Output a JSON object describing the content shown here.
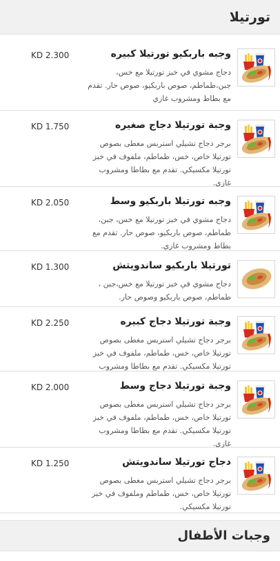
{
  "section_title": "تورتيلا",
  "kids_title": "وجبات الأطفال",
  "items": [
    {
      "name": "وجبه باربكيو تورتيلا كبيره",
      "desc": "دجاج مشوي في خبز تورتيلا مع خس، جبن،طماطم، صوص باربكيو، صوص حار. تقدم مع بطاط ومشروب غازي",
      "price": "KD 2.300",
      "meal": true
    },
    {
      "name": "وجبة تورتيلا دجاج صغيره",
      "desc": "برجر دجاج تشيلي استربس مغطى بصوص تورتيلا خاص، خس، طماطم، ملفوف في خبز تورتيلا مكسيكي. تقدم مع بطاطا ومشروب غازي.",
      "price": "KD 1.750",
      "meal": true
    },
    {
      "name": "وجبه تورتيلا باربكيو وسط",
      "desc": "دجاج مشوي في خبز تورتيلا مع خس، جبن، طماطم، صوص باربكيو، صوص حار. تقدم مع بطاط ومشروب غازي.",
      "price": "KD 2.050",
      "meal": true
    },
    {
      "name": "تورتيلا باربكيو ساندويتش",
      "desc": "دجاج مشوي في خبز تورتيلا مع خس،جبن ، طماطم، صوص باربكيو وصوص حار.",
      "price": "KD 1.300",
      "meal": false
    },
    {
      "name": "وجبة تورتيلا دجاج كبيره",
      "desc": "برجر دجاج تشيلي استربس مغطى بصوص تورتيلا خاص، خس، طماطم، ملفوف في خبز تورتيلا مكسيكي. تقدم مع بطاطا ومشروب غازي.",
      "price": "KD 2.250",
      "meal": true
    },
    {
      "name": "وجبة تورتيلا دجاج وسط",
      "desc": "برجر دجاج تشيلي استربس مغطى بصوص تورتيلا خاص، خس، طماطم، ملفوف في خبز تورتيلا مكسيكي. تقدم مع بطاطا ومشروب غازي.",
      "price": "KD 2.000",
      "meal": true
    },
    {
      "name": "دجاج تورتيلا ساندويتش",
      "desc": "برجر دجاج تشيلي استربس مغطى بصوص تورتيلا خاص، خس، طماطم وملفوف في خبز تورتيلا مكسيكي.",
      "price": "KD 1.250",
      "meal": true
    }
  ]
}
